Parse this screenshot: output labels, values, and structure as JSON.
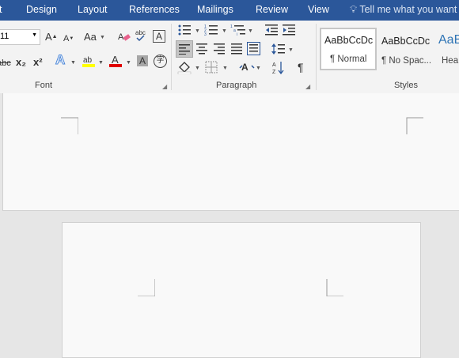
{
  "tabs": [
    "t",
    "Design",
    "Layout",
    "References",
    "Mailings",
    "Review",
    "View"
  ],
  "tell_me": "Tell me what you want",
  "font": {
    "size": "11",
    "grow_label": "A",
    "shrink_label": "A",
    "case_label": "Aa",
    "strike_label": "abc",
    "subscript_label": "x₂",
    "superscript_label": "x²",
    "group_label": "Font"
  },
  "paragraph": {
    "group_label": "Paragraph"
  },
  "styles": {
    "items": [
      {
        "sample": "AaBbCcDc",
        "name": "¶ Normal"
      },
      {
        "sample": "AaBbCcDc",
        "name": "¶ No Spac..."
      },
      {
        "sample": "AaBl",
        "name": "Hea"
      }
    ],
    "group_label": "Styles"
  },
  "colors": {
    "tab_bar": "#2b579a",
    "highlight": "#ffff00",
    "font_color": "#e00000"
  }
}
